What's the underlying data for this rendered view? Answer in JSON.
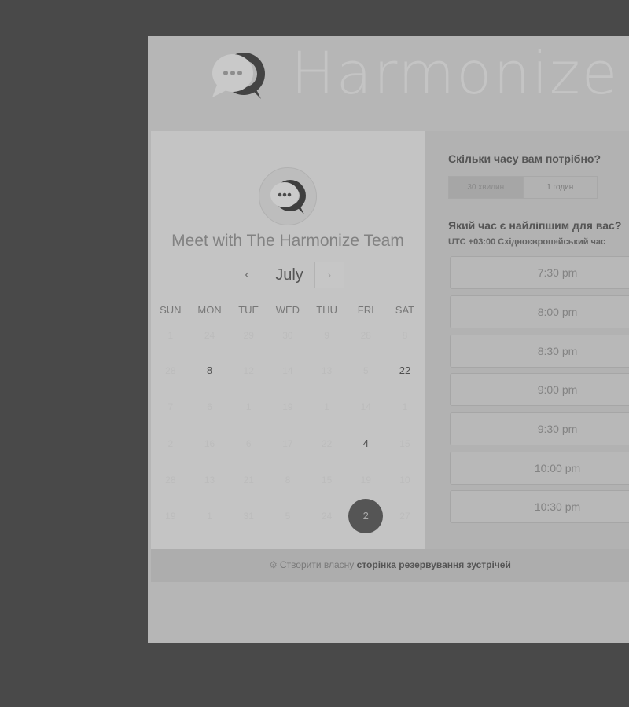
{
  "brand": {
    "name": "Harmonize"
  },
  "host": {
    "title": "Meet with The Harmonize Team"
  },
  "calendar": {
    "month": "July",
    "prev_symbol": "‹",
    "next_symbol": "›",
    "weekdays": [
      "SUN",
      "MON",
      "TUE",
      "WED",
      "THU",
      "FRI",
      "SAT"
    ],
    "weeks": [
      [
        "1",
        "24",
        "29",
        "30",
        "9",
        "28",
        "8"
      ],
      [
        "28",
        "8",
        "12",
        "14",
        "13",
        "5",
        "22"
      ],
      [
        "7",
        "6",
        "1",
        "19",
        "1",
        "14",
        "1"
      ],
      [
        "2",
        "16",
        "6",
        "17",
        "22",
        "4",
        "15"
      ],
      [
        "28",
        "13",
        "21",
        "8",
        "15",
        "19",
        "10"
      ],
      [
        "19",
        "1",
        "31",
        "5",
        "24",
        "2",
        "27"
      ]
    ],
    "available_days": [
      "8",
      "22",
      "4"
    ],
    "selected_day": "2"
  },
  "booking": {
    "duration_heading": "Скільки часу вам потрібно?",
    "durations": [
      "30 хвилин",
      "1 годин"
    ],
    "selected_duration": "30 хвилин",
    "time_heading": "Який час є найліпшим для вас?",
    "timezone_offset": "UTC +03:00",
    "timezone_name": "Східноєвропейський час",
    "slots": [
      "7:30 pm",
      "8:00 pm",
      "8:30 pm",
      "9:00 pm",
      "9:30 pm",
      "10:00 pm",
      "10:30 pm"
    ]
  },
  "footer": {
    "icon": "hubspot-sprocket-icon",
    "prefix": "Створити власну",
    "emphasis": "сторінка резервування зустрічей"
  },
  "colors": {
    "overlay": "#494949",
    "selected_day": "#555555"
  }
}
